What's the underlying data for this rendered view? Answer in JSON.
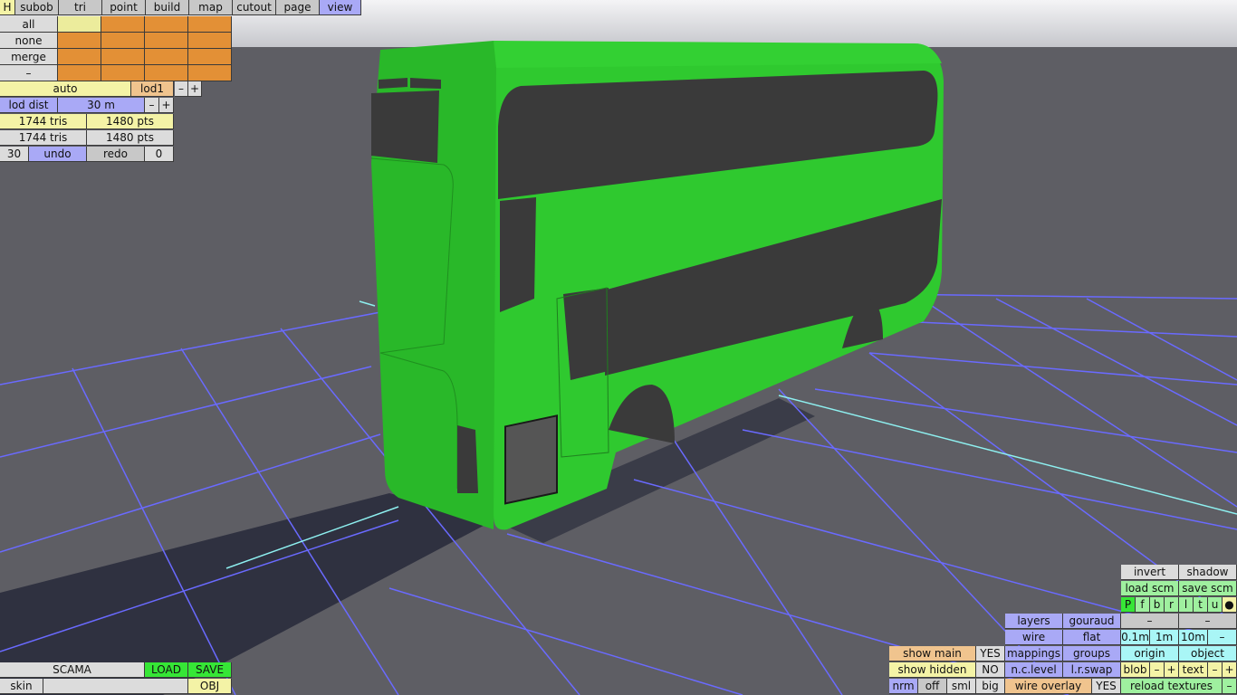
{
  "top_menu": {
    "h": "H",
    "subob": "subob",
    "tri": "tri",
    "point": "point",
    "build": "build",
    "map": "map",
    "cutout": "cutout",
    "page": "page",
    "view": "view"
  },
  "selection": {
    "all": "all",
    "none": "none",
    "merge": "merge",
    "dash": "–"
  },
  "lod": {
    "auto": "auto",
    "level": "lod1",
    "minus": "–",
    "plus": "+",
    "dist_label": "lod dist",
    "dist_value": "30 m"
  },
  "stats": {
    "row1_tris": "1744 tris",
    "row1_pts": "1480 pts",
    "row2_tris": "1744 tris",
    "row2_pts": "1480 pts"
  },
  "history": {
    "count": "30",
    "undo": "undo",
    "redo": "redo",
    "redo_count": "0"
  },
  "file": {
    "name": "SCAMA",
    "load": "LOAD",
    "save": "SAVE",
    "skin": "skin",
    "obj": "OBJ"
  },
  "view_panel": {
    "invert": "invert",
    "shadow": "shadow",
    "load_scm": "load scm",
    "save_scm": "save scm",
    "views": [
      "P",
      "f",
      "b",
      "r",
      "l",
      "t",
      "u",
      "●"
    ],
    "dash": "–",
    "layers": "layers",
    "gouraud": "gouraud",
    "wire": "wire",
    "flat": "flat",
    "grid": [
      "0.1m",
      "1m",
      "10m",
      "–"
    ],
    "mappings": "mappings",
    "groups": "groups",
    "origin": "origin",
    "object": "object",
    "show_main": "show main",
    "show_main_val": "YES",
    "show_hidden": "show hidden",
    "show_hidden_val": "NO",
    "nc_level": "n.c.level",
    "lr_swap": "l.r.swap",
    "blob": "blob",
    "text": "text",
    "nrm": "nrm",
    "off": "off",
    "sml": "sml",
    "big": "big",
    "wire_overlay": "wire overlay",
    "wire_overlay_val": "YES",
    "reload_textures": "reload textures"
  },
  "colors": {
    "model": "#2fc92f",
    "window": "#3a3a3a",
    "grid": "#6a6aff",
    "axis": "#8ef0f0",
    "floor": "#5e5e64"
  }
}
